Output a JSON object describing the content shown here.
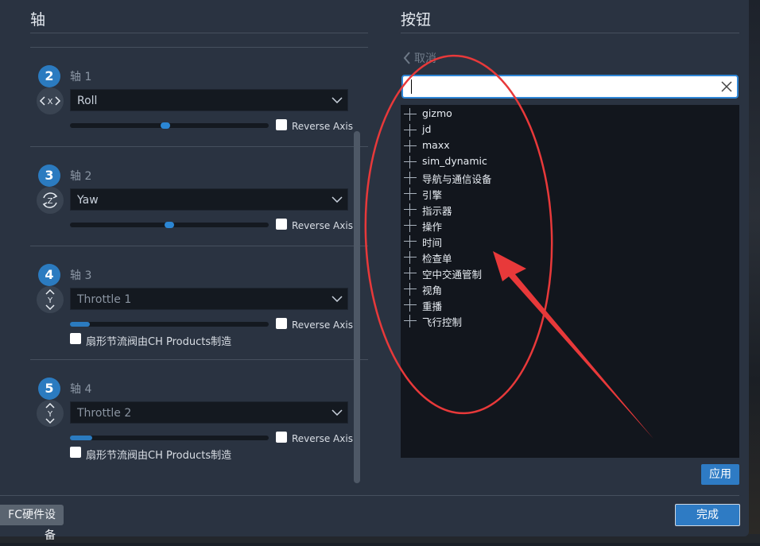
{
  "left_panel": {
    "title": "轴",
    "axes": [
      {
        "number": "2",
        "label": "轴 1",
        "icon": "X",
        "dropdown": "Roll",
        "disabled": false,
        "slider_fraction": 0.48,
        "slider_kind": "thumb",
        "reverse_label": "Reverse Axis",
        "extra_checkbox_label": null
      },
      {
        "number": "3",
        "label": "轴 2",
        "icon": "Z",
        "dropdown": "Yaw",
        "disabled": false,
        "slider_fraction": 0.5,
        "slider_kind": "thumb",
        "reverse_label": "Reverse Axis",
        "extra_checkbox_label": null
      },
      {
        "number": "4",
        "label": "轴 3",
        "icon": "Y",
        "dropdown": "Throttle 1",
        "disabled": true,
        "slider_fraction": 0.1,
        "slider_kind": "fill",
        "reverse_label": "Reverse Axis",
        "extra_checkbox_label": "扇形节流阀由CH Products制造"
      },
      {
        "number": "5",
        "label": "轴 4",
        "icon": "Y",
        "dropdown": "Throttle 2",
        "disabled": true,
        "slider_fraction": 0.11,
        "slider_kind": "fill",
        "reverse_label": "Reverse Axis",
        "extra_checkbox_label": "扇形节流阀由CH Products制造"
      }
    ]
  },
  "right_panel": {
    "title": "按钮",
    "cancel_label": "取消",
    "search": {
      "value": "",
      "placeholder": ""
    },
    "tree_items": [
      "gizmo",
      "jd",
      "maxx",
      "sim_dynamic",
      "导航与通信设备",
      "引擎",
      "指示器",
      "操作",
      "时间",
      "检查单",
      "空中交通管制",
      "视角",
      "重播",
      "飞行控制"
    ],
    "apply_label": "应用"
  },
  "footer": {
    "gfc_label": "FC硬件设备",
    "done_label": "完成"
  },
  "colors": {
    "accent": "#2b7bc0",
    "dialog_bg": "#2a3341",
    "annotation_red": "#e8393a"
  }
}
